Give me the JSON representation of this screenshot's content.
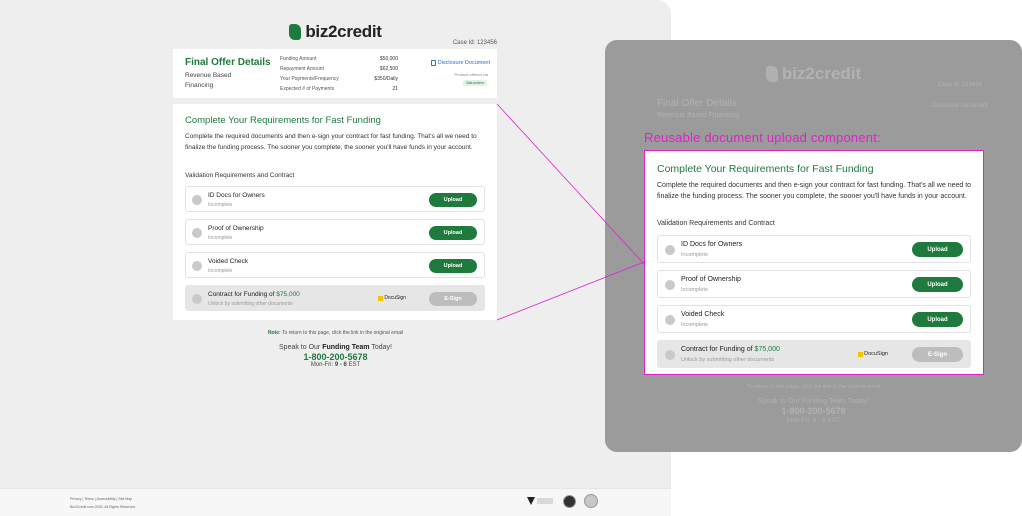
{
  "brand": {
    "name": "biz2credit"
  },
  "case_id": "Case Id: 123456",
  "offer": {
    "title": "Final Offer Details",
    "subtitle": "Revenue Based Financing",
    "rows": [
      {
        "label": "Funding Amount",
        "value": "$50,000"
      },
      {
        "label": "Repayment Amount",
        "value": "$62,500"
      },
      {
        "label": "Your Payments/Frequency",
        "value": "$350/Daily"
      },
      {
        "label": "Expected # of Payments",
        "value": "21"
      }
    ],
    "disclosure_label": "Disclosure Document",
    "offered_via": "Product offered via",
    "lender_tag": "BizLenders"
  },
  "requirements": {
    "title": "Complete Your Requirements for Fast Funding",
    "description": "Complete the required documents and then e-sign your contract for fast funding. That's all we need to finalize the funding process. The sooner you complete, the sooner you'll have funds in your account.",
    "section_label": "Validation Requirements and Contract",
    "items": [
      {
        "name": "ID Docs for Owners",
        "status": "Incomplete",
        "action": "Upload"
      },
      {
        "name": "Proof of Ownership",
        "status": "Incomplete",
        "action": "Upload"
      },
      {
        "name": "Voided Check",
        "status": "Incomplete",
        "action": "Upload"
      }
    ],
    "contract": {
      "name_prefix": "Contract for Funding of ",
      "amount": "$75,000",
      "status": "Unlock by submitting other documents",
      "provider": "DocuSign",
      "action": "E-Sign"
    }
  },
  "note": {
    "label": "Note:",
    "text": " To return to this page, click the link in the original email"
  },
  "contact": {
    "speak_prefix": "Speak to Our ",
    "team": "Funding Team",
    "speak_suffix": " Today!",
    "phone": "1-800-200-5678",
    "hours_prefix": "Mon-Fri: ",
    "hours": "9 - 6",
    "hours_suffix": " EST"
  },
  "footer": {
    "links": "Privacy | Terms | Accessibility | Site Map",
    "copyright": "Biz2Credit.com 2023. All Rights Reserved"
  },
  "callout": {
    "caption": "Reusable document upload component:"
  },
  "colors": {
    "brand_green": "#1f7a3d",
    "highlight_magenta": "#e020c8",
    "overlay_gray": "#9b9b9b"
  }
}
